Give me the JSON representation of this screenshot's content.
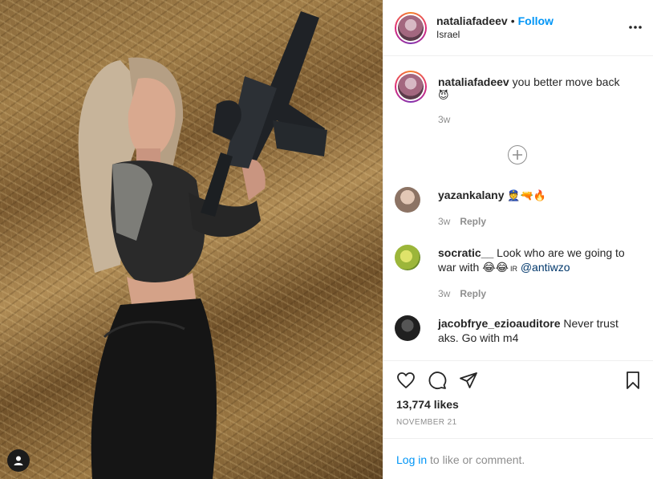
{
  "post": {
    "author": {
      "username": "nataliafadeev",
      "follow_label": "Follow",
      "separator": "•",
      "location": "Israel"
    },
    "more_icon": "more-options-icon",
    "caption": {
      "username": "nataliafadeev",
      "text": "you better move back",
      "emoji": "😈",
      "time": "3w"
    },
    "load_more_icon": "plus-circle-icon",
    "comments": [
      {
        "username": "yazankalany",
        "text": "👮🔫🔥",
        "time": "3w",
        "reply_label": "Reply"
      },
      {
        "username": "socratic__",
        "text": "Look who are we going to war with 😂😂",
        "mention_prefix": "IR",
        "mention": "@antiwzo",
        "time": "3w",
        "reply_label": "Reply"
      },
      {
        "username": "jacobfrye_ezioauditore",
        "text": "Never trust aks. Go with m4"
      }
    ],
    "actions": {
      "like_icon": "heart-icon",
      "comment_icon": "comment-icon",
      "share_icon": "share-icon",
      "save_icon": "bookmark-icon"
    },
    "likes": "13,774 likes",
    "date": "NOVEMBER 21",
    "login": {
      "link_label": "Log in",
      "text": "to like or comment."
    }
  },
  "colors": {
    "link": "#0095f6",
    "muted": "#8e8e8e",
    "text": "#262626",
    "border": "#efefef"
  }
}
